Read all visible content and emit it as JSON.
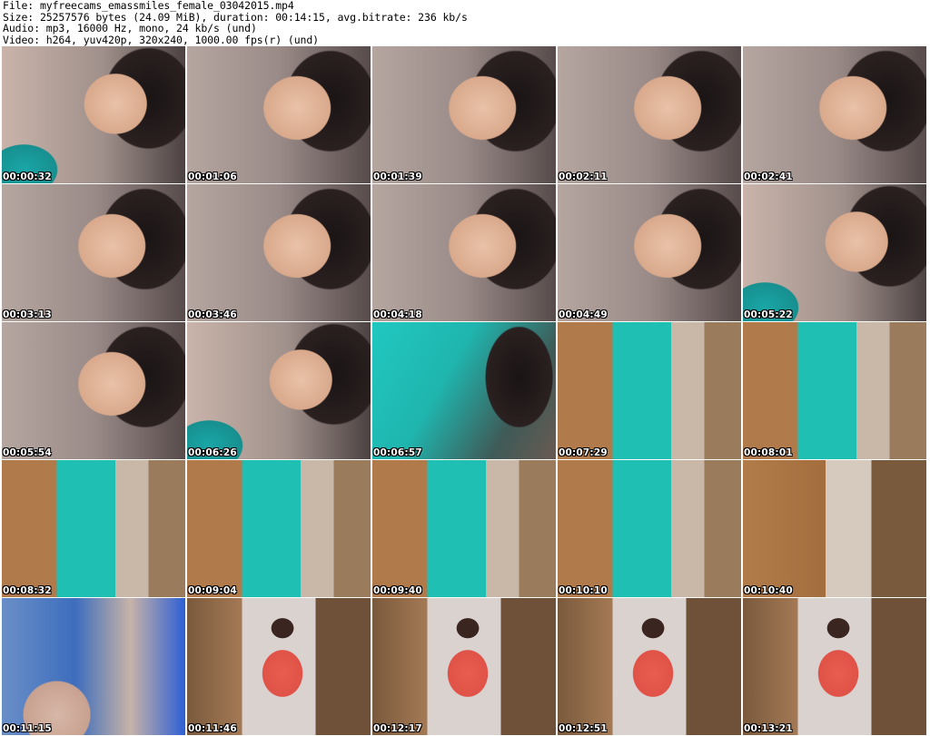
{
  "header": {
    "file": "File: myfreecams_emassmiles_female_03042015.mp4",
    "size": "Size: 25257576 bytes (24.09 MiB), duration: 00:14:15, avg.bitrate: 236 kb/s",
    "audio": "Audio: mp3, 16000 Hz, mono, 24 kb/s (und)",
    "video": "Video: h264, yuv420p, 320x240, 1000.00 fps(r) (und)"
  },
  "thumbnails": [
    {
      "time": "00:00:32",
      "scene": "face-teal"
    },
    {
      "time": "00:01:06",
      "scene": "face"
    },
    {
      "time": "00:01:39",
      "scene": "face"
    },
    {
      "time": "00:02:11",
      "scene": "face"
    },
    {
      "time": "00:02:41",
      "scene": "face"
    },
    {
      "time": "00:03:13",
      "scene": "face"
    },
    {
      "time": "00:03:46",
      "scene": "face"
    },
    {
      "time": "00:04:18",
      "scene": "face"
    },
    {
      "time": "00:04:49",
      "scene": "face"
    },
    {
      "time": "00:05:22",
      "scene": "face-teal"
    },
    {
      "time": "00:05:54",
      "scene": "face"
    },
    {
      "time": "00:06:26",
      "scene": "face-teal"
    },
    {
      "time": "00:06:57",
      "scene": "dress-close"
    },
    {
      "time": "00:07:29",
      "scene": "room-dress"
    },
    {
      "time": "00:08:01",
      "scene": "room-dress"
    },
    {
      "time": "00:08:32",
      "scene": "room-dress"
    },
    {
      "time": "00:09:04",
      "scene": "room-dress"
    },
    {
      "time": "00:09:40",
      "scene": "room-dress"
    },
    {
      "time": "00:10:10",
      "scene": "room-dress"
    },
    {
      "time": "00:10:40",
      "scene": "room"
    },
    {
      "time": "00:11:15",
      "scene": "room-legs"
    },
    {
      "time": "00:11:46",
      "scene": "room-person"
    },
    {
      "time": "00:12:17",
      "scene": "room-person"
    },
    {
      "time": "00:12:51",
      "scene": "room-person"
    },
    {
      "time": "00:13:21",
      "scene": "room-person"
    }
  ]
}
